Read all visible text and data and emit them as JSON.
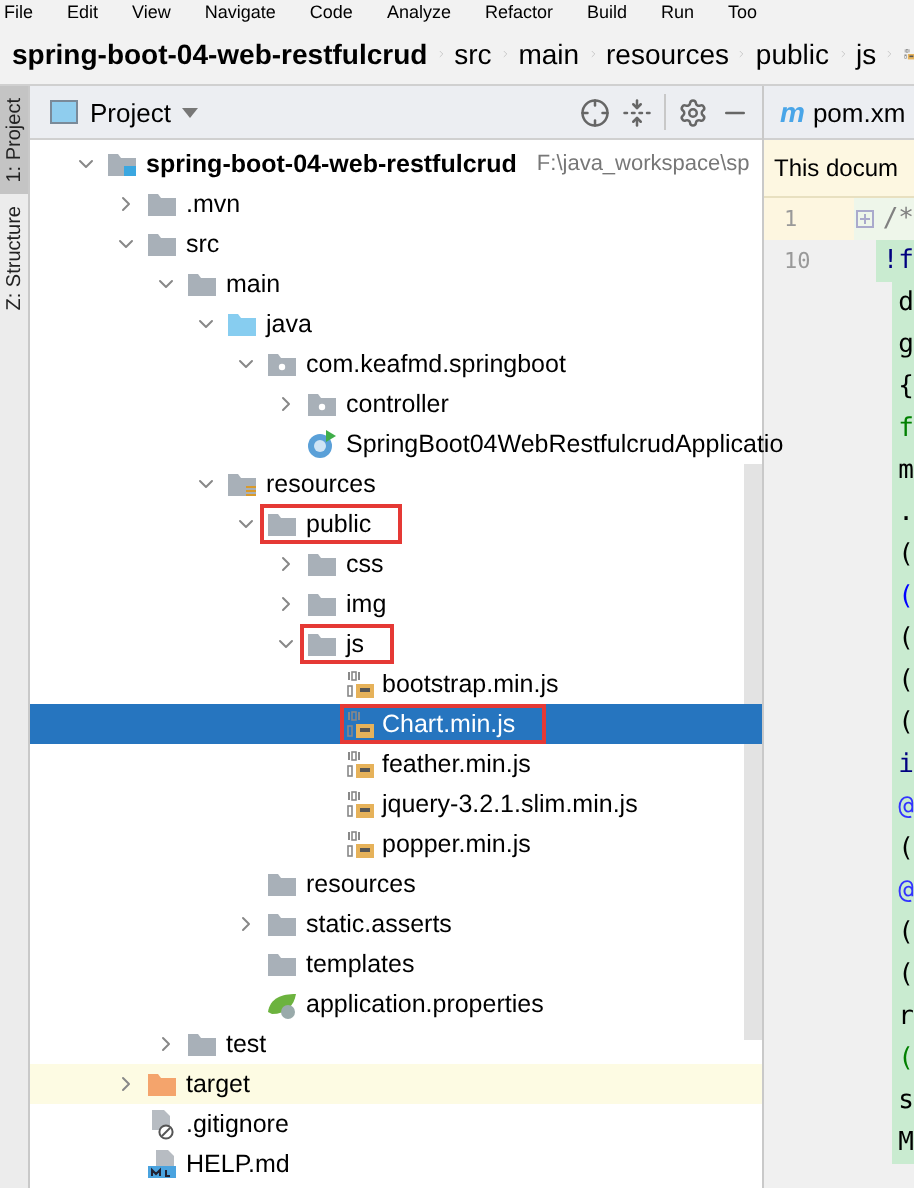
{
  "menu": [
    "File",
    "Edit",
    "View",
    "Navigate",
    "Code",
    "Analyze",
    "Refactor",
    "Build",
    "Run",
    "Too"
  ],
  "breadcrumbs": [
    {
      "label": "spring-boot-04-web-restfulcrud",
      "kind": "project"
    },
    {
      "label": "src",
      "kind": "folder"
    },
    {
      "label": "main",
      "kind": "folder"
    },
    {
      "label": "resources",
      "kind": "folder"
    },
    {
      "label": "public",
      "kind": "folder"
    },
    {
      "label": "js",
      "kind": "folder"
    }
  ],
  "tool_windows": [
    {
      "label": "1: Project",
      "selected": true
    },
    {
      "label": "Z: Structure",
      "selected": false
    }
  ],
  "panel": {
    "title": "Project"
  },
  "tree": [
    {
      "label": "spring-boot-04-web-restfulcrud",
      "path": "F:\\java_workspace\\sp",
      "kind": "module",
      "expanded": true,
      "selected": false,
      "children": [
        {
          "label": ".mvn",
          "kind": "folder",
          "expanded": false,
          "selected": false
        },
        {
          "label": "src",
          "kind": "folder",
          "expanded": true,
          "selected": false,
          "children": [
            {
              "label": "main",
              "kind": "folder",
              "expanded": true,
              "selected": false,
              "children": [
                {
                  "label": "java",
                  "kind": "source",
                  "expanded": true,
                  "selected": false,
                  "children": [
                    {
                      "label": "com.keafmd.springboot",
                      "kind": "package",
                      "expanded": true,
                      "selected": false,
                      "children": [
                        {
                          "label": "controller",
                          "kind": "package",
                          "expanded": false,
                          "selected": false
                        },
                        {
                          "label": "SpringBoot04WebRestfulcrudApplicatio",
                          "kind": "class",
                          "selected": false
                        }
                      ]
                    }
                  ]
                },
                {
                  "label": "resources",
                  "kind": "resources",
                  "expanded": true,
                  "selected": false,
                  "children": [
                    {
                      "label": "public",
                      "kind": "folder",
                      "expanded": true,
                      "selected": false,
                      "outlined": true,
                      "children": [
                        {
                          "label": "css",
                          "kind": "folder",
                          "expanded": false,
                          "selected": false
                        },
                        {
                          "label": "img",
                          "kind": "folder",
                          "expanded": false,
                          "selected": false
                        },
                        {
                          "label": "js",
                          "kind": "folder",
                          "expanded": true,
                          "selected": false,
                          "outlined": true,
                          "children": [
                            {
                              "label": "bootstrap.min.js",
                              "kind": "js",
                              "selected": false
                            },
                            {
                              "label": "Chart.min.js",
                              "kind": "js",
                              "selected": true,
                              "outlined": true
                            },
                            {
                              "label": "feather.min.js",
                              "kind": "js",
                              "selected": false
                            },
                            {
                              "label": "jquery-3.2.1.slim.min.js",
                              "kind": "js",
                              "selected": false
                            },
                            {
                              "label": "popper.min.js",
                              "kind": "js",
                              "selected": false
                            }
                          ]
                        }
                      ]
                    },
                    {
                      "label": "resources",
                      "kind": "folder",
                      "selected": false
                    },
                    {
                      "label": "static.asserts",
                      "kind": "folder",
                      "expanded": false,
                      "selected": false
                    },
                    {
                      "label": "templates",
                      "kind": "folder",
                      "selected": false
                    },
                    {
                      "label": "application.properties",
                      "kind": "properties",
                      "selected": false
                    }
                  ]
                }
              ]
            },
            {
              "label": "test",
              "kind": "folder",
              "expanded": false,
              "selected": false
            }
          ]
        },
        {
          "label": "target",
          "kind": "excluded",
          "expanded": false,
          "selected": false
        },
        {
          "label": ".gitignore",
          "kind": "ignore",
          "selected": false
        },
        {
          "label": "HELP.md",
          "kind": "markdown",
          "selected": false
        }
      ]
    }
  ],
  "editor": {
    "tab_icon": "m",
    "tab": "pom.xm",
    "notice": "This docum",
    "lines": [
      {
        "number": "1",
        "text": "/*",
        "color": "#808080"
      },
      {
        "number": "10",
        "text": "!f",
        "color": "#000080"
      },
      {
        "text": "d",
        "color": "#000000"
      },
      {
        "text": "g",
        "color": "#000000"
      },
      {
        "text": "{",
        "color": "#000000"
      },
      {
        "text": "f",
        "color": "#008000"
      },
      {
        "text": "m",
        "color": "#000000"
      },
      {
        "text": ".",
        "color": "#000000"
      },
      {
        "text": "(",
        "color": "#000000"
      },
      {
        "text": "(",
        "color": "#0000ff"
      },
      {
        "text": "(",
        "color": "#000000"
      },
      {
        "text": "(",
        "color": "#000000"
      },
      {
        "text": "(",
        "color": "#000000"
      },
      {
        "text": "i",
        "color": "#000080"
      },
      {
        "text": "@",
        "color": "#3333ff"
      },
      {
        "text": "(",
        "color": "#000000"
      },
      {
        "text": "@",
        "color": "#3333ff"
      },
      {
        "text": "(",
        "color": "#000000"
      },
      {
        "text": "(",
        "color": "#000000"
      },
      {
        "text": "r",
        "color": "#000000"
      },
      {
        "text": "(",
        "color": "#008000"
      },
      {
        "text": "s",
        "color": "#000000"
      },
      {
        "text": "M",
        "color": "#000000"
      }
    ]
  }
}
